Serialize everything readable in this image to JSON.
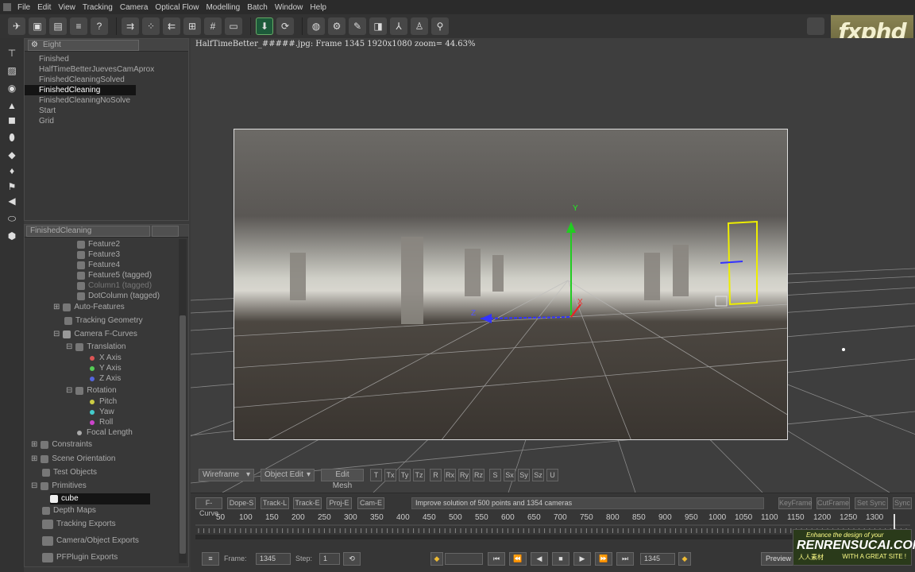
{
  "menu": [
    "File",
    "Edit",
    "View",
    "Tracking",
    "Camera",
    "Optical Flow",
    "Modelling",
    "Batch",
    "Window",
    "Help"
  ],
  "logo": "fxphd",
  "tree": {
    "root": "Eight",
    "items": [
      "Finished",
      "HalfTimeBetterJuevesCamAprox",
      "FinishedCleaningSolved",
      "FinishedCleaning",
      "FinishedCleaningNoSolve",
      "Start",
      "Grid"
    ],
    "selected_index": 3
  },
  "browser": {
    "combo": "FinishedCleaning",
    "features": [
      "Feature2",
      "Feature3",
      "Feature4",
      "Feature5 (tagged)",
      "Column1 (tagged)",
      "DotColumn (tagged)"
    ],
    "auto_features": "Auto-Features",
    "tracking_geometry": "Tracking Geometry",
    "camera_fcurves": "Camera F-Curves",
    "translation": "Translation",
    "x_axis": "X Axis",
    "y_axis": "Y Axis",
    "z_axis": "Z Axis",
    "rotation": "Rotation",
    "pitch": "Pitch",
    "yaw": "Yaw",
    "roll": "Roll",
    "focal_length": "Focal Length",
    "constraints": "Constraints",
    "scene_orientation": "Scene Orientation",
    "test_objects": "Test Objects",
    "primitives": "Primitives",
    "cube": "cube",
    "depth_maps": "Depth Maps",
    "tracking_exports": "Tracking Exports",
    "camera_object_exports": "Camera/Object Exports",
    "pfplugin_exports": "PFPlugin Exports"
  },
  "viewport": {
    "title": "HalfTimeBetter_#####.jpg: Frame 1345  1920x1080  zoom= 44.63%",
    "axis_y": "Y",
    "axis_z": "Z",
    "axis_x": "X"
  },
  "vptools": {
    "display": "Wireframe",
    "mode": "Object Edit",
    "edit_mesh": "Edit Mesh",
    "transforms": [
      "T",
      "Tx",
      "Ty",
      "Tz",
      "R",
      "Rx",
      "Ry",
      "Rz",
      "S",
      "Sx",
      "Sy",
      "Sz",
      "U"
    ]
  },
  "timeline": {
    "tabs": [
      "F-Curve",
      "Dope-S",
      "Track-L",
      "Track-E",
      "Proj-E",
      "Cam-E"
    ],
    "status": "Improve solution of 500 points and 1354 cameras",
    "right_buttons": [
      "KeyFrame",
      "CutFrame",
      "Set Sync",
      "Sync"
    ],
    "ticks": [
      "50",
      "100",
      "150",
      "200",
      "250",
      "300",
      "350",
      "400",
      "450",
      "500",
      "550",
      "600",
      "650",
      "700",
      "750",
      "800",
      "850",
      "900",
      "950",
      "1000",
      "1050",
      "1100",
      "1150",
      "1200",
      "1250",
      "1300"
    ],
    "frame_label": "Frame:",
    "frame_value": "1345",
    "step_label": "Step:",
    "step_value": "1",
    "end_frame": "1345",
    "preview": "Preview"
  },
  "watermark": {
    "line1": "Enhance the design of your",
    "line2": "RENRENSUCAI.COM",
    "line3": "人人素材",
    "line4": "WITH A GREAT SITE !"
  }
}
